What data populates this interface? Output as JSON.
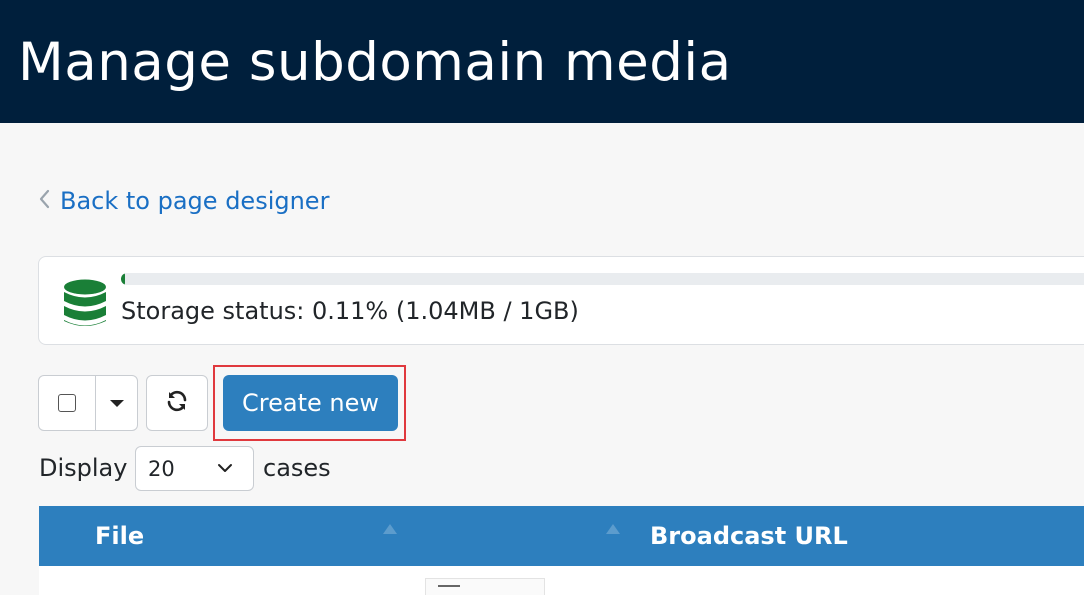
{
  "page": {
    "title": "Manage subdomain media",
    "back_link": "Back to page designer"
  },
  "storage": {
    "status_text": "Storage status: 0.11% (1.04MB / 1GB)",
    "used_fraction": 0.0011,
    "bar_color": "#1a7f37"
  },
  "toolbar": {
    "create_label": "Create new",
    "refresh_icon": "refresh-icon",
    "select_all_icon": "checkbox-icon",
    "dropdown_icon": "caret-down-icon"
  },
  "pagination": {
    "display_label": "Display",
    "page_size": "20",
    "cases_label": "cases"
  },
  "table": {
    "columns": [
      {
        "label": "File"
      },
      {
        "label": "Broadcast URL"
      }
    ]
  },
  "colors": {
    "header_bg": "#001f3c",
    "accent": "#2d7fbe",
    "link": "#1a6fc4",
    "highlight": "#e0393e"
  }
}
